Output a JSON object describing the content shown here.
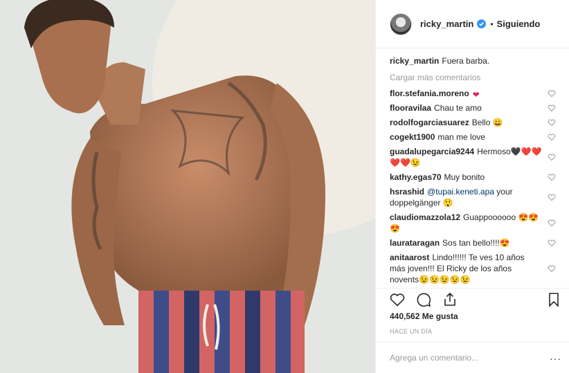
{
  "post": {
    "username": "ricky_martin",
    "follow_status": "Siguiendo",
    "separator": "•",
    "caption_user": "ricky_martin",
    "caption_text": "Fuera barba.",
    "load_more": "Cargar más comentarios",
    "likes": "440,562 Me gusta",
    "timestamp": "HACE UN DÍA",
    "comment_placeholder": "Agrega un comentario...",
    "more_options": "···"
  },
  "comments": [
    {
      "user": "flor.stefania.moreno",
      "text": "",
      "emoji": "❤"
    },
    {
      "user": "flooravilaa",
      "text": "Chau te amo",
      "emoji": ""
    },
    {
      "user": "rodolfogarciasuarez",
      "text": "Bello",
      "emoji": "😀"
    },
    {
      "user": "cogekt1900",
      "text": "man me love",
      "emoji": ""
    },
    {
      "user": "guadalupegarcia9244",
      "text": "Hermoso",
      "emoji": "🖤❤️❤️❤️❤️😉"
    },
    {
      "user": "kathy.egas70",
      "text": "Muy bonito",
      "emoji": ""
    },
    {
      "user": "hsrashid",
      "mention": "@tupai.keneti.apa",
      "text": "your doppelgänger",
      "emoji": "😲"
    },
    {
      "user": "claudiomazzola12",
      "text": "Guappoooooo",
      "emoji": "😍😍😍"
    },
    {
      "user": "laurataragan",
      "text": "Sos tan bello!!!!",
      "emoji": "😍"
    },
    {
      "user": "anitaarost",
      "text": "Lindo!!!!!! Te ves 10 años más joven!!! El Ricky de los años novents",
      "emoji": "😉😉😉😉😉"
    }
  ],
  "icons": [
    "verified-badge-icon",
    "heart-icon",
    "comment-icon",
    "share-icon",
    "bookmark-icon",
    "small-heart-icon"
  ],
  "colors": {
    "verified": "#3897f0",
    "text": "#262626",
    "muted": "#999999",
    "mention": "#003569",
    "border": "#efefef"
  }
}
